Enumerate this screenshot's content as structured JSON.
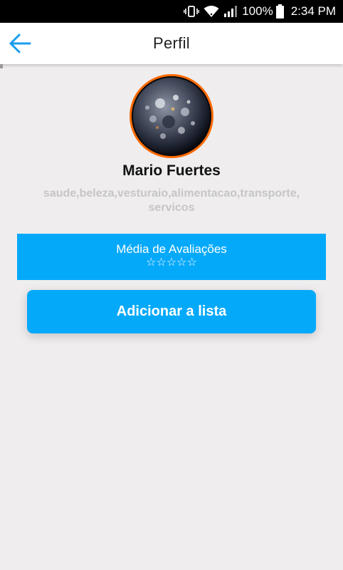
{
  "status_bar": {
    "battery": "100%",
    "time": "2:34 PM",
    "icons": [
      "vibrate-icon",
      "wifi-icon",
      "signal-icon",
      "battery-icon"
    ]
  },
  "app_bar": {
    "title": "Perfil",
    "back_icon": "arrow-left-icon"
  },
  "profile": {
    "name": "Mario Fuertes",
    "categories": "saude,beleza,vesturaio,alimentacao,transporte, servicos",
    "avatar_icon": "planet-avatar"
  },
  "rating": {
    "label": "Média de Avaliações",
    "stars": "☆☆☆☆☆",
    "value": 0,
    "max": 5
  },
  "actions": {
    "add_label": "Adicionar a lista"
  },
  "colors": {
    "accent": "#05a9fa",
    "avatar_border": "#ff6a00",
    "background": "#efedee",
    "category_text": "#c6c6c6"
  }
}
